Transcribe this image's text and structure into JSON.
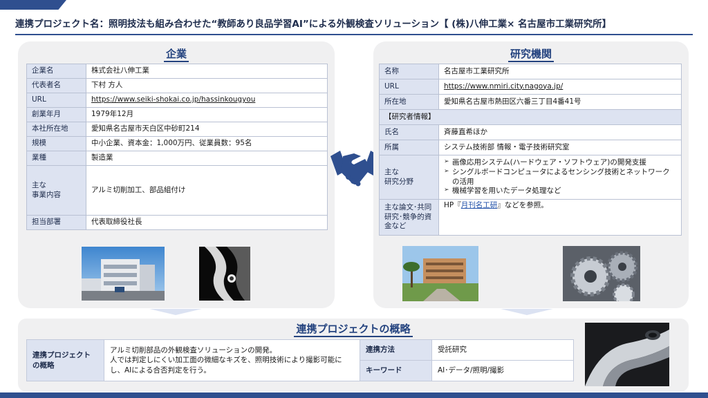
{
  "header": {
    "title": "連携プロジェクト名：照明技法も組み合わせた“教師あり良品学習AI”による外観検査ソリューション【 (株)八伸工業× 名古屋市工業研究所】"
  },
  "company": {
    "heading": "企業",
    "rows": [
      {
        "label": "企業名",
        "value": "株式会社八伸工業"
      },
      {
        "label": "代表者名",
        "value": "下村 方人"
      },
      {
        "label": "URL",
        "value": "https://www.seiki-shokai.co.jp/hassinkougyou"
      },
      {
        "label": "創業年月",
        "value": "1979年12月"
      },
      {
        "label": "本社所在地",
        "value": "愛知県名古屋市天白区中砂町214"
      },
      {
        "label": "規模",
        "value": "中小企業、資本金：1,000万円、従業員数：95名"
      },
      {
        "label": "業種",
        "value": "製造業"
      },
      {
        "label": "主な\n事業内容",
        "value": "アルミ切削加工、部品組付け"
      },
      {
        "label": "担当部署",
        "value": "代表取締役社長"
      }
    ]
  },
  "institute": {
    "heading": "研究機関",
    "rows": [
      {
        "label": "名称",
        "value": "名古屋市工業研究所"
      },
      {
        "label": "URL",
        "value": "https://www.nmiri.city.nagoya.jp/"
      },
      {
        "label": "所在地",
        "value": "愛知県名古屋市熱田区六番三丁目4番41号"
      }
    ],
    "researcher_section": "【研究者情報】",
    "researcher_rows": [
      {
        "label": "氏名",
        "value": "斉藤直希ほか"
      },
      {
        "label": "所属",
        "value": "システム技術部 情報・電子技術研究室"
      }
    ],
    "fields_label": "主な\n研究分野",
    "fields": [
      "画像応用システム(ハードウェア・ソフトウェア)の開発支援",
      "シングルボードコンピュータによるセンシング技術とネットワークの活用",
      "機械学習を用いたデータ処理など"
    ],
    "papers_label": "主な論文･共同研究･競争的資金など",
    "papers_prefix": "HP『",
    "papers_link": "月刊名工研",
    "papers_suffix": "』などを参照。"
  },
  "project": {
    "heading": "連携プロジェクトの概略",
    "overview_label": "連携プロジェクト\nの概略",
    "overview_text": "アルミ切削部品の外観検査ソリューションの開発。\n人では判定しにくい加工面の微細なキズを、照明技術により撮影可能にし、AIによる合否判定を行う。",
    "method_label": "連携方法",
    "method_value": "受託研究",
    "keyword_label": "キーワード",
    "keyword_value": "AI･データ/照明/撮影"
  },
  "colors": {
    "accent": "#2f4f8f",
    "heading": "#24437f",
    "label_bg": "#dde3f1",
    "panel_bg": "#f0f0f1"
  }
}
